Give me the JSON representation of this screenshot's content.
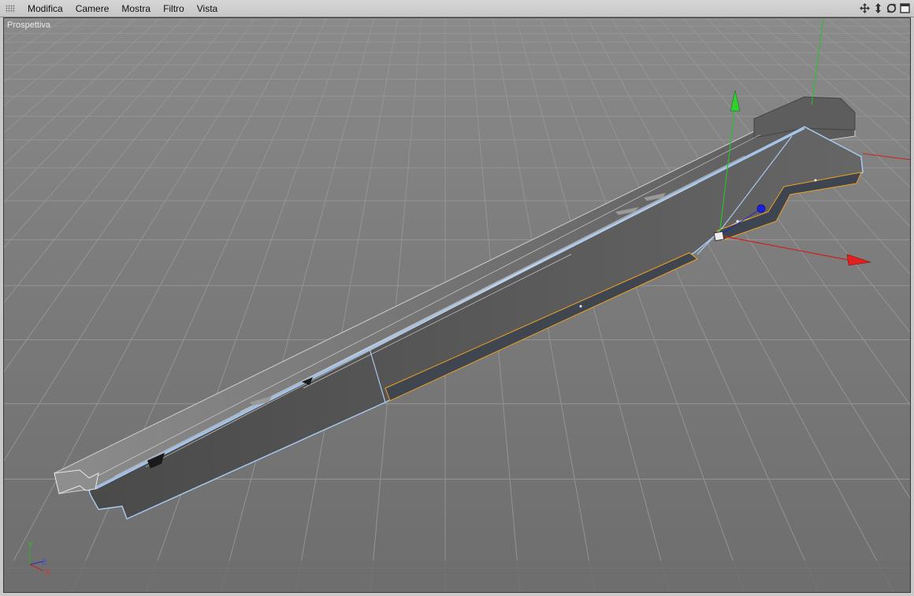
{
  "menu": {
    "items": [
      {
        "label": "Modifica"
      },
      {
        "label": "Camere"
      },
      {
        "label": "Mostra"
      },
      {
        "label": "Filtro"
      },
      {
        "label": "Vista"
      }
    ]
  },
  "nav_icons": [
    "move-view-icon",
    "dolly-view-icon",
    "rotate-view-icon",
    "maximize-view-icon"
  ],
  "viewport": {
    "label": "Prospettiva",
    "axis_labels": {
      "y": "Y",
      "z": "Z",
      "x": "X"
    }
  },
  "colors": {
    "menubar": "#cfcfcf",
    "grid_bg": "#7b7b7b",
    "grid_line": "#9a9a9a",
    "model_face": "#5a5a5a",
    "selection_edge": "#a9c8ee",
    "selected_edge": "#f0a020",
    "axis_x": "#e02020",
    "axis_y": "#20c020",
    "axis_z": "#2020d0"
  }
}
